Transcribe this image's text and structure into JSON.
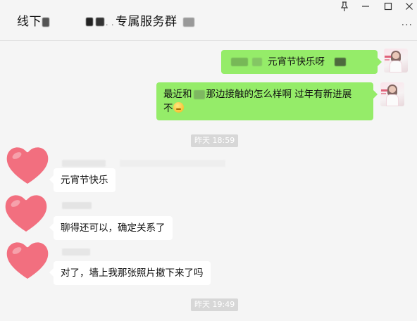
{
  "window": {
    "title_prefix": "线下",
    "title_suffix": "专属服务群",
    "pin_icon": "pin-icon",
    "minimize_label": "–",
    "maximize_label": "☐",
    "close_label": "✕",
    "more_label": "···"
  },
  "messages": [
    {
      "side": "out",
      "text": "元宵节快乐呀"
    },
    {
      "side": "out",
      "text_a": "最近和",
      "text_b": "那边接触的怎么样啊  过年有新进展",
      "text_c": "不",
      "emoji": "thinking-emoji"
    },
    {
      "side": "time",
      "text": "昨天 18:59"
    },
    {
      "side": "in",
      "text": "元宵节快乐"
    },
    {
      "side": "in",
      "text": "聊得还可以，确定关系了"
    },
    {
      "side": "in",
      "text": "对了，墙上我那张照片撤下来了吗"
    },
    {
      "side": "time",
      "text": "昨天 19:49"
    }
  ],
  "colors": {
    "outgoing_bubble": "#95ec69",
    "incoming_bubble": "#ffffff",
    "background": "#f5f5f5",
    "avatar_heart": "#f26f7f"
  },
  "icons": [
    "pin-icon",
    "minimize-icon",
    "maximize-icon",
    "close-icon",
    "more-icon",
    "heart-avatar",
    "photo-avatar"
  ]
}
